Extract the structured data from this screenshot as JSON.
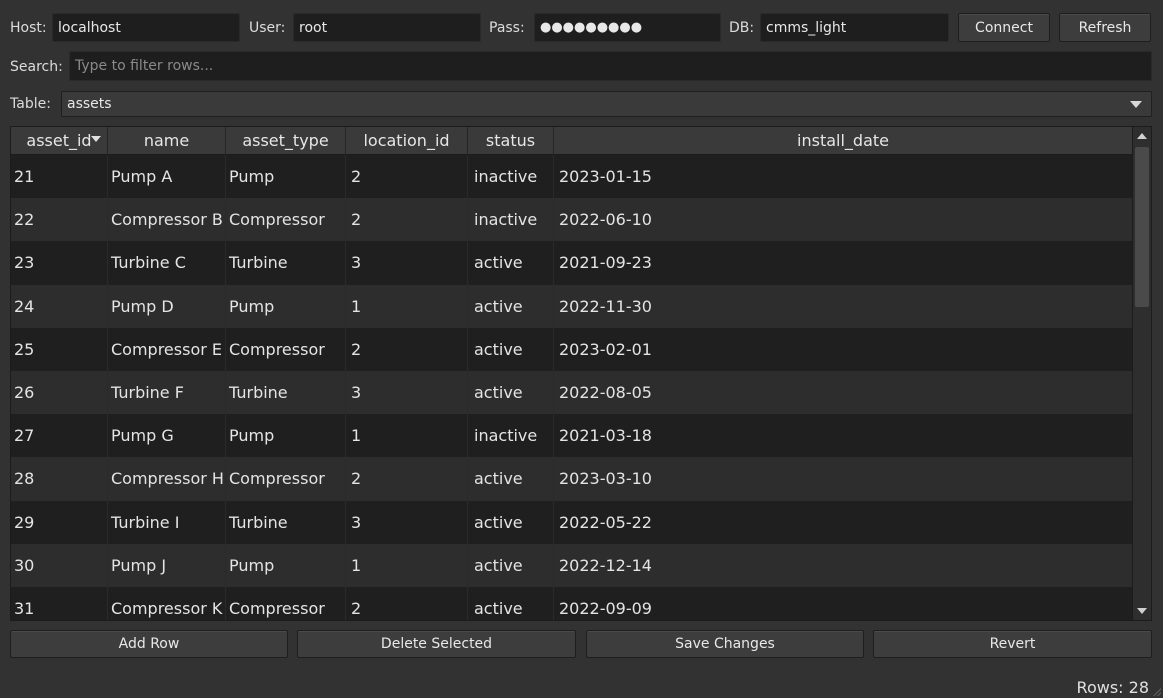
{
  "connection": {
    "host_label": "Host:",
    "host_value": "localhost",
    "user_label": "User:",
    "user_value": "root",
    "pass_label": "Pass:",
    "pass_value": "●●●●●●●●●",
    "db_label": "DB:",
    "db_value": "cmms_light",
    "connect_label": "Connect",
    "refresh_label": "Refresh"
  },
  "search": {
    "label": "Search:",
    "placeholder": "Type to filter rows..."
  },
  "table_select": {
    "label": "Table:",
    "selected": "assets"
  },
  "grid": {
    "columns": [
      "asset_id",
      "name",
      "asset_type",
      "location_id",
      "status",
      "install_date"
    ],
    "sorted_column": "asset_id",
    "rows": [
      [
        "21",
        "Pump A",
        "Pump",
        "2",
        "inactive",
        "2023-01-15"
      ],
      [
        "22",
        "Compressor B",
        "Compressor",
        "2",
        "inactive",
        "2022-06-10"
      ],
      [
        "23",
        "Turbine C",
        "Turbine",
        "3",
        "active",
        "2021-09-23"
      ],
      [
        "24",
        "Pump D",
        "Pump",
        "1",
        "active",
        "2022-11-30"
      ],
      [
        "25",
        "Compressor E",
        "Compressor",
        "2",
        "active",
        "2023-02-01"
      ],
      [
        "26",
        "Turbine F",
        "Turbine",
        "3",
        "active",
        "2022-08-05"
      ],
      [
        "27",
        "Pump G",
        "Pump",
        "1",
        "inactive",
        "2021-03-18"
      ],
      [
        "28",
        "Compressor H",
        "Compressor",
        "2",
        "active",
        "2023-03-10"
      ],
      [
        "29",
        "Turbine I",
        "Turbine",
        "3",
        "active",
        "2022-05-22"
      ],
      [
        "30",
        "Pump J",
        "Pump",
        "1",
        "active",
        "2022-12-14"
      ],
      [
        "31",
        "Compressor K",
        "Compressor",
        "2",
        "active",
        "2022-09-09"
      ]
    ]
  },
  "actions": {
    "add_row": "Add Row",
    "delete_selected": "Delete Selected",
    "save_changes": "Save Changes",
    "revert": "Revert"
  },
  "status_bar": {
    "rows_text": "Rows: 28"
  }
}
